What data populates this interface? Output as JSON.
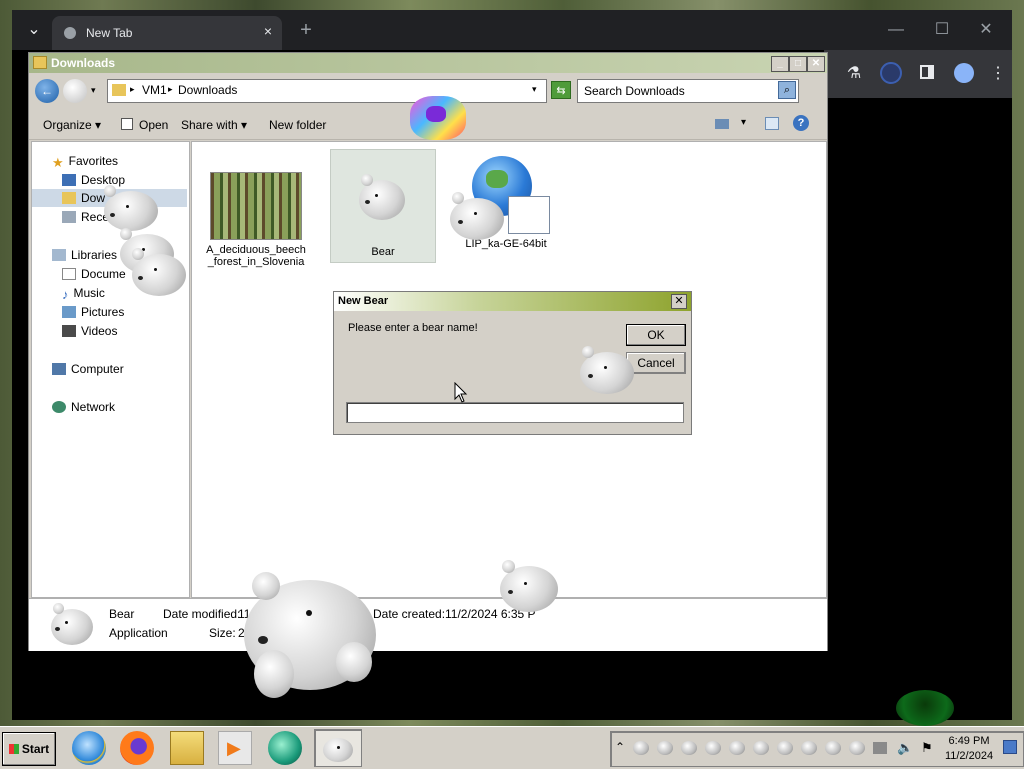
{
  "chrome": {
    "tab_title": "New Tab",
    "tab_close": "×",
    "new_tab": "+",
    "minimize": "—",
    "maximize": "☐",
    "close": "✕"
  },
  "explorer": {
    "title": "Downloads",
    "address": [
      "VM1",
      "Downloads"
    ],
    "search_placeholder": "Search Downloads",
    "commands": [
      "Organize",
      "Open",
      "Share with",
      "New folder"
    ],
    "nav": {
      "favorites": "Favorites",
      "desktop": "Desktop",
      "downloads": "Dow",
      "recent": "Rece",
      "libraries": "Libraries",
      "documents": "Docume",
      "music": "Music",
      "pictures": "Pictures",
      "videos": "Videos",
      "computer": "Computer",
      "network": "Network"
    },
    "files": [
      {
        "name": "A_deciduous_beech_forest_in_Slovenia",
        "icon": "image-thumbnail"
      },
      {
        "name": "Bear",
        "icon": "bear-icon"
      },
      {
        "name": "LIP_ka-GE-64bit",
        "icon": "globe-installer-icon"
      }
    ],
    "details": {
      "name": "Bear",
      "type": "Application",
      "modified_label": "Date modified:",
      "modified_value": "11",
      "size_label": "Size:",
      "size_value": "2",
      "created_label": "Date created:",
      "created_value": "11/2/2024 6:35 P"
    }
  },
  "dialog": {
    "title": "New Bear",
    "prompt": "Please enter a bear name!",
    "ok": "OK",
    "cancel": "Cancel",
    "input_value": ""
  },
  "taskbar": {
    "start": "Start",
    "time": "6:49 PM",
    "date": "11/2/2024"
  },
  "colors": {
    "titlebar": "#a7b78a",
    "dialog_title": "#8ea32d",
    "taskbar": "#d4d0c8"
  }
}
